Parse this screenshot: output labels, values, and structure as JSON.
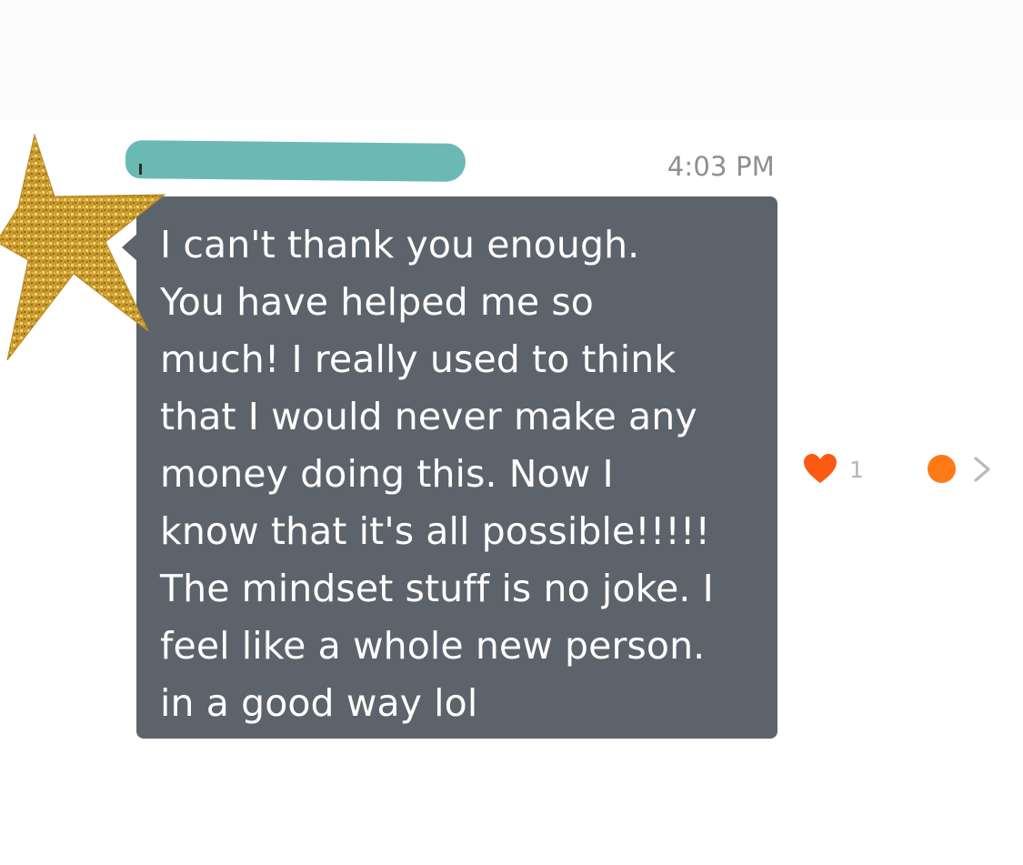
{
  "conversation": {
    "timestamp": "4:03 PM",
    "message": {
      "text": "I can't thank you enough.\nYou have helped me so\nmuch! I really used to think\nthat I would never make any\nmoney doing this. Now I\nknow that it's all possible!!!!!\nThe mindset stuff is no joke. I\nfeel like a whole new person.\nin a good way lol",
      "bubble_color": "#5d636b",
      "text_color": "#ffffff"
    },
    "sender_name_redaction_color": "#6bb9b5",
    "reactions": {
      "like_icon": "heart-icon",
      "like_count": "1",
      "accent_color": "#fc5a12"
    },
    "status_dot_color": "#ff7a17",
    "navigation_icon": "chevron-right-icon",
    "decoration": {
      "icon": "gold-glitter-star-icon",
      "color": "#c99a2e"
    }
  }
}
